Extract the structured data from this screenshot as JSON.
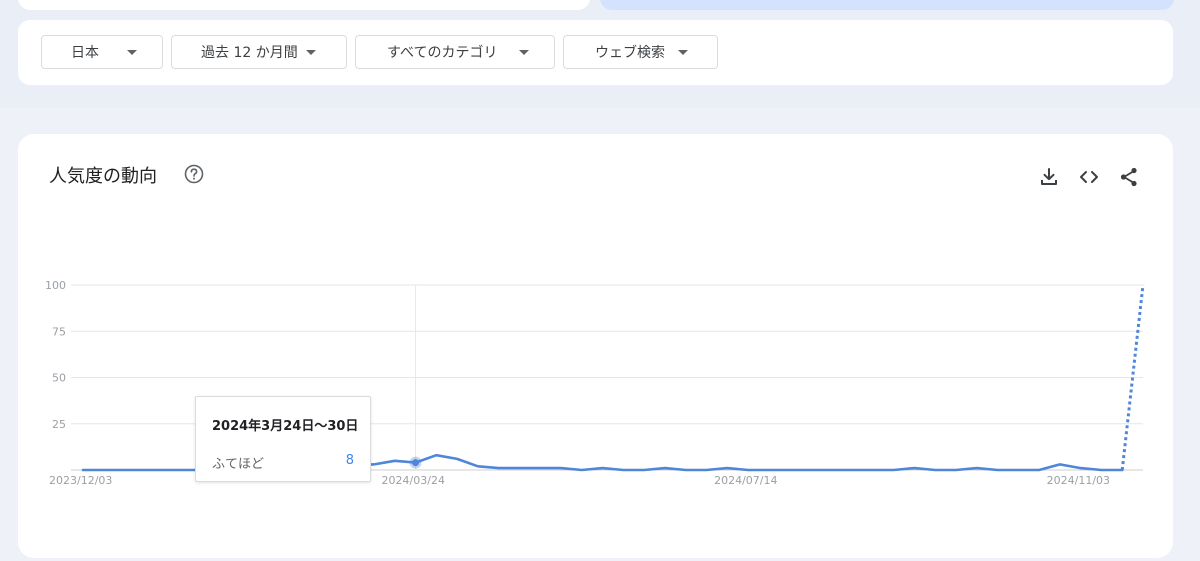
{
  "filters": [
    {
      "label": "日本"
    },
    {
      "label": "過去 12 か月間"
    },
    {
      "label": "すべてのカテゴリ"
    },
    {
      "label": "ウェブ検索"
    }
  ],
  "chart_panel": {
    "title": "人気度の動向",
    "icons": [
      "help-icon",
      "download-icon",
      "embed-icon",
      "share-icon"
    ]
  },
  "tooltip": {
    "date": "2024年3月24日〜30日",
    "term": "ふてほど",
    "value": "8"
  },
  "colors": {
    "series": "#4f86d8",
    "grid": "#e6e6e6",
    "axis_text": "#9aa0a6",
    "tooltip_value": "#4285f4"
  },
  "chart_data": {
    "type": "line",
    "title": "",
    "xlabel": "",
    "ylabel": "",
    "ylim": [
      0,
      100
    ],
    "yticks": [
      25,
      50,
      75,
      100
    ],
    "grid": true,
    "x_tick_labels": [
      "2023/12/03",
      "2024/03/24",
      "2024/07/14",
      "2024/11/03"
    ],
    "x_tick_week_index": [
      0,
      16,
      32,
      48
    ],
    "highlight_week_index": 16,
    "series": [
      {
        "name": "ふてほど",
        "values": [
          0,
          0,
          0,
          0,
          0,
          0,
          0,
          0,
          0,
          0,
          1,
          2,
          3,
          3,
          3,
          5,
          4,
          8,
          6,
          2,
          1,
          1,
          1,
          1,
          0,
          1,
          0,
          0,
          1,
          0,
          0,
          1,
          0,
          0,
          0,
          0,
          0,
          0,
          0,
          0,
          1,
          0,
          0,
          1,
          0,
          0,
          0,
          3,
          1,
          0,
          0,
          100
        ],
        "partial_last_point": true
      }
    ]
  }
}
